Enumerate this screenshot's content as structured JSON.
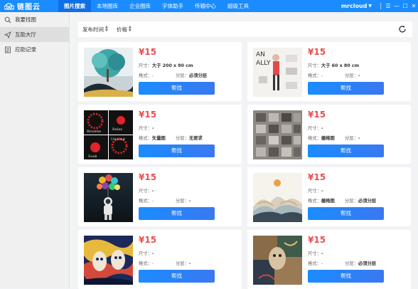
{
  "app": {
    "name": "链图云"
  },
  "nav": {
    "tabs": [
      "图片搜索",
      "本地图库",
      "企业图库",
      "字体助手",
      "传输中心",
      "超级工具"
    ],
    "user": "mrcloud"
  },
  "sidebar": {
    "items": [
      {
        "label": "我要找图",
        "icon": "search-icon"
      },
      {
        "label": "互助大厅",
        "icon": "send-icon"
      },
      {
        "label": "应助记录",
        "icon": "list-icon"
      }
    ]
  },
  "filters": {
    "time_label": "发布时间",
    "price_label": "价格"
  },
  "cards": [
    {
      "price": "¥15",
      "size_label": "尺寸：",
      "size": "大于 200 x 80 cm",
      "format_label": "格式：",
      "format": "-",
      "layer_label": "分层：",
      "layer": "必须分层",
      "button": "帮找",
      "thumb": "tree-art"
    },
    {
      "price": "¥15",
      "size_label": "尺寸：",
      "size": "大于 60 x 80 cm",
      "format_label": "格式：",
      "format": "-",
      "layer_label": "分层：",
      "layer": "-",
      "button": "帮找",
      "thumb": "fashion-sketch"
    },
    {
      "price": "¥15",
      "size_label": "尺寸：",
      "size": "-",
      "format_label": "格式：",
      "format": "矢量图",
      "layer_label": "分层：",
      "layer": "无要求",
      "button": "帮找",
      "thumb": "red-flowers"
    },
    {
      "price": "¥15",
      "size_label": "尺寸：",
      "size": "-",
      "format_label": "格式：",
      "format": "栅格图",
      "layer_label": "分层：",
      "layer": "-",
      "button": "帮找",
      "thumb": "pattern-wall"
    },
    {
      "price": "¥15",
      "size_label": "尺寸：",
      "size": "-",
      "format_label": "格式：",
      "format": "-",
      "layer_label": "分层：",
      "layer": "-",
      "button": "帮找",
      "thumb": "astronaut-balloons"
    },
    {
      "price": "¥15",
      "size_label": "尺寸：",
      "size": "-",
      "format_label": "格式：",
      "format": "栅格图",
      "layer_label": "分层：",
      "layer": "必须分层",
      "button": "帮找",
      "thumb": "ink-landscape"
    },
    {
      "price": "¥15",
      "size_label": "尺寸：",
      "size": "-",
      "format_label": "格式：",
      "format": "-",
      "layer_label": "分层：",
      "layer": "-",
      "button": "帮找",
      "thumb": "faces-art"
    },
    {
      "price": "¥15",
      "size_label": "尺寸：",
      "size": "-",
      "format_label": "格式：",
      "format": "-",
      "layer_label": "分层：",
      "layer": "必须分层",
      "button": "帮找",
      "thumb": "collage-art"
    }
  ],
  "colors": {
    "primary": "#1a8cff",
    "price": "#e84f4f",
    "sidebar_bg": "#f0f0f0",
    "page_bg": "#f2f3f5"
  }
}
